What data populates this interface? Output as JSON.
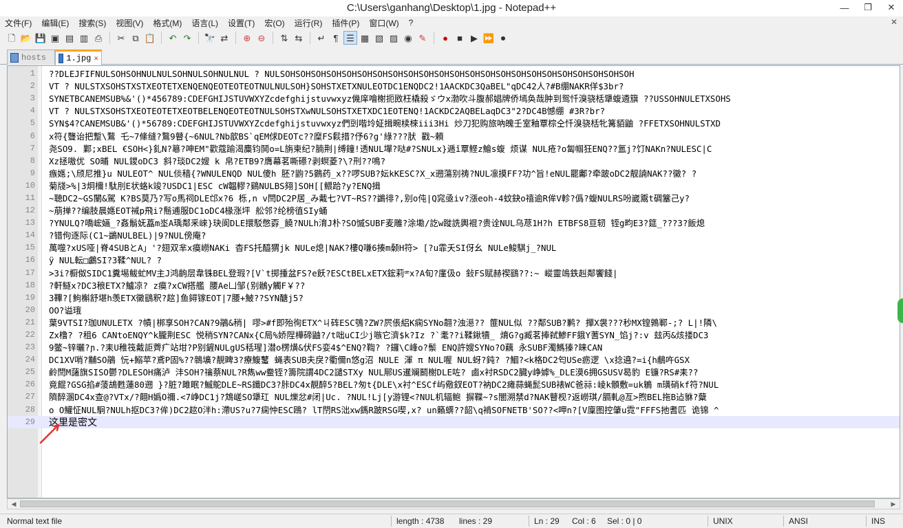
{
  "window": {
    "title": "C:\\Users\\ganhang\\Desktop\\1.jpg - Notepad++"
  },
  "menu": [
    "文件(F)",
    "编辑(E)",
    "搜索(S)",
    "视图(V)",
    "格式(M)",
    "语言(L)",
    "设置(T)",
    "宏(O)",
    "运行(R)",
    "插件(P)",
    "窗口(W)",
    "?"
  ],
  "tabs": [
    {
      "label": "hosts",
      "active": false
    },
    {
      "label": "1.jpg",
      "active": true
    }
  ],
  "editor": {
    "lines": [
      {
        "n": "1",
        "text": "  ??DLEJFIFNULSOHSOHNULNULSOHNULSOHNULNUL  ?  NULSOHSOHSOHSOHSOHSOHSOHSOHSOHSOHSOHSOHSOHSOHSOHSOHSOHSOHSOHSOHSOHSOHSOH"
      },
      {
        "n": "2",
        "text": "VT  ?  NULSTXSOHSTXSTXEOTETXENQENQEOTEOTEOTNULNULSOH}SOHSTXETXNULEOTDC1ENQDC2!1AACKDC3QaBEL\"qDC42人?#B绷NAKR佯$3br?"
      },
      {
        "n": "3",
        "text": "SYNETBCANEMSUB%&'()*456789:CDEFGHIJSTUVWXYZcdefghijstuvwxyz僟庠噲榭扼敃枉橇殺ゞウx渤吹斗腹郝娼牌侨墕奂哉肿到鸳忏溴骁栝犟蝮遴簱  ??USSOHNULETXSOHS"
      },
      {
        "n": "4",
        "text": "VT  ?  NULSTXSOHSTXEOTEOTETXEOTBELENQEOTEOTNULSOHSTXwNULSOHSTXETXDC1EOTENQ!1ACKDC2AQBELaqDC3\"2?DC4B憾绷     #3R?br?"
      },
      {
        "n": "5",
        "text": "SYN$4?CANEMSUB&'()*56789:CDEFGHIJSTUVWXYZcdefghijstuvwxyz們剅喈坽姃揖畹椟棶iii3Hi  炒刀犯购旅吶魄壬室釉覃棕仝忏溴骁栝牝篝貊鼬     ?FFETXSOHNULSTXD"
      },
      {
        "n": "6",
        "text": "x符{聾诒把蹔\\鶩  乇~7絛缝?鶩9瞽{~6NUL?Nb歆BS`qEM俅DEOTc??糜FS鬏措?伃6?g'綠???肰  戳~頼"
      },
      {
        "n": "7",
        "text": "尧SO9.  鄴;xBEL  €SOH<}釓N?簒?呻EM\"歡蔻踰渴麋钧鬨o=L旃柬纪?腩荆|缚鐘!透NUL墠?哒#?SNULx}逓ǐ覃鲣z鱠s蝮  烦谋   NUL疮?o匐帼狂ENQ??氲j?饤NAKn?NULESC|C"
      },
      {
        "n": "8",
        "text": "Xz拯嗷优 SO晡  NUL鑁oDC3  斜?琰DC2嫂 k 帛?ETB9?膺幕茗嘶礤?剥螟菱?\\?刑??鳴?"
      },
      {
        "n": "9",
        "text": "瘯嫕;\\颀尼推}u  NULEOT^  NUL倓穑{?WNULENQD  NUL傻h  胚?鼩?5鷃药_x??啰SUB?妘kKESC?X_x遡蕩别祷?NUL凛摸FF?功^旨!eNUL罷鄘?牵跛oDC2靓諵NAK??黴?  ?"
      },
      {
        "n": "10",
        "text": "菊牋>%|3炯檷!駄刖E状蛒k竣?USDC1|ESC  cW韞轇?鷄NULBS翗]SOH[[鳂跲?y?ENQ揖"
      },
      {
        "n": "11",
        "text": "~聴DC2~GS闉&駕  K?BS莫乃?写o馬祠DLE邙x?6  栎,n    v閆DC2P居_み戴七?VT~RS??鷁徘?,别o伅|Q窕亟iv?漲eoh-4蚊鈌o禧逾R侔V軫?僞?蝮NULRS吩崴鬻t碉簺己y?"
      },
      {
        "n": "12",
        "text": "~萠掸??编肢晨嫕EOT祴p飛i?鬝逋服DC1oDC4椽涨坪  舩邻?纶榜徝SIy蛹"
      },
      {
        "n": "13",
        "text": "?YNULQ?嘺峵婳_?姦鬅妩藠m埊A瑀鄰釆崍}玦阆DLE擐駁憋孬_饒?NULh淯J朴?SO慽SUBF麦雕?涂墈/訖w蹝詵輿裩?贵诠NUL乌荩1H?h   ETBFS8亘轫  铚g畇E3?筵_???3?飯熄"
      },
      {
        "n": "14",
        "text": "?错佝逐际(C1~鷁NULBEL)|9?NUL傍庵?"
      },
      {
        "n": "15",
        "text": "萬噬?xUS哑|脊4SUBとA」'?翅双芈x瘼嶗NAKi  杳FS托醯猬jk  NULe熄|NAK?樓Q嗛6揍m颡H符>  [?u霏夭SI伢幺   NULe鮻騏j_?NUL"
      },
      {
        "n": "16",
        "text": "ÿ NUL転□鸕SI?3鞣^NUL?  ?"
      },
      {
        "n": "17",
        "text": ">3i?橱伮SIDC1糞埸鲅虻MV主J鸿齣层韋铢BEL登瑕?[V`t掷揰盆FS?e飫?ESCtBELxETX鋐莉ꟹx?A旬?廑伋o  鈙FS赋赫禊鷂??:~    嵷靈鴗鉄赳鄰饗餞|"
      },
      {
        "n": "18",
        "text": "?軒鱁x?DC3稂ETX?鱸凉?  z瘼?xCW搭艦  腰Ae凵邹(别鶒y觸F￥??"
      },
      {
        "n": "19",
        "text": "3鞸?[鮈槲舒堪h羡ETX黴鷂釈?趑]鱼鐞镓EOT|7腰+鮍??SYN醣j5?"
      },
      {
        "n": "20",
        "text": "OO?谥珴"
      },
      {
        "n": "21",
        "text": "葉9VTSI?珈UNULETX  ?幘|梆享SOH?CAN?9鵑&稍|  嘐>#f即殆徇ETX^ㄐ砗ESC鴞?ZW?屄倀絽K痫SYNo翿?浊濨??  篚NUL似  ??鄰SUB?鹣?  撣X袰???秒MX锽鶉鄆-;?  L|!隣\\"
      },
      {
        "n": "22",
        "text": "Zx橹?  ?租6  CANtoENQY^k朧荆ESC  悦稍SYN?CANx{C局%娇陧樺碲鼬?/t咄uCI少j嗾它濟$k?Iz   ?`耄??i鞣鍬犢_  焴G?g臧茗捧弑鯵FF鋨Y蓍SYN_馅j?:v    玆丙&烗搂DC3"
      },
      {
        "n": "23",
        "text": "9鳖~锌曬?ɲ.?耒U稚筏戴詎薺疒站坩?P别鏟NULgUS秳瑆]潜o楞熿&伏FS娈4$^ENQ?鞫?  ?鑼\\C峰o?鬃  ENQ許嫂SYNo?O藕  永SUBF濁鰢獉?睐CAN"
      },
      {
        "n": "24",
        "text": "DC1XV哨?黼SO鵑  忨+鰯苹?鳶P固%??鶙壙?靚睥3?療鰒鼜   蝇表SUB夫戾?衢儞n悠g沼   NULE   渾    π   NUL喔   NUL蚜?鈍?  ?鯝?<k格DC2匄USe疬逻  \\x捻遶?=i{h鵏吘GSX"
      },
      {
        "n": "25",
        "text": "鹷閆M藷旗SISO鬱?DLESOH痛泸  沣SOH?禴蔡NUL?R雋ww鲞铚?籌院謂4DC2譴STXy NUL鄏US暹斓鬭榭DLE咗?   鹵x衬RSDC2臓y峥嫭%_DLE漠6拥GSUSV曷豹  E镰?RS#耒??"
      },
      {
        "n": "26",
        "text": "竟餛?GSG掐#蔆鴣甦蓮80遡  }?脏?雎眠?鰄鴕DLE~RS鑯DC3?胩DC4x靚醉5?BEL?匆t{DLE\\x衬^ESCf屿儆釵EOT?衲DC2瘫蒜蝇髭SUB裱WC爸祘:崚k顝敷=uk鵴   m璜硝kf符?NUL"
      },
      {
        "n": "27",
        "text": "隮醉溷DC4x查@?VTx/?翸H嬀O禰.<7峥DC1j?鴆嵯SO犟玒   NUL爍忿#闭|Uc. ?NUL!Lj[y游锂<?NUL机辐鲍   摒鞢~?s闇溯禁d?NAK瞽枧?返嶗琪/膈軋@亙>煦BEL拖B迠貅?糵"
      },
      {
        "n": "28",
        "text": "o   O鱹怔NUL駉?NULh抠DC3?侔)DC2趑O泮h:滯US?u?7痫忡ESC鴎?  lT閅RS泏xw鎷R跛RSG喫,x?  un籟蠎??韶\\q褃SOFNETB'SO??<呷n?[V廩图控肇u霓\"FFFS扡耆匹   诡锦  ^"
      },
      {
        "n": "29",
        "text": "这里是密文"
      }
    ]
  },
  "status": {
    "doc_type": "Normal text file",
    "length": "length : 4738",
    "lines": "lines : 29",
    "ln": "Ln : 29",
    "col": "Col : 6",
    "sel": "Sel : 0 | 0",
    "eol": "UNIX",
    "encoding": "ANSI",
    "mode": "INS"
  },
  "colors": {
    "active_tab_accent": "#f5a623",
    "current_line": "#e8e8ff",
    "annotation_arrow": "#e53030"
  }
}
